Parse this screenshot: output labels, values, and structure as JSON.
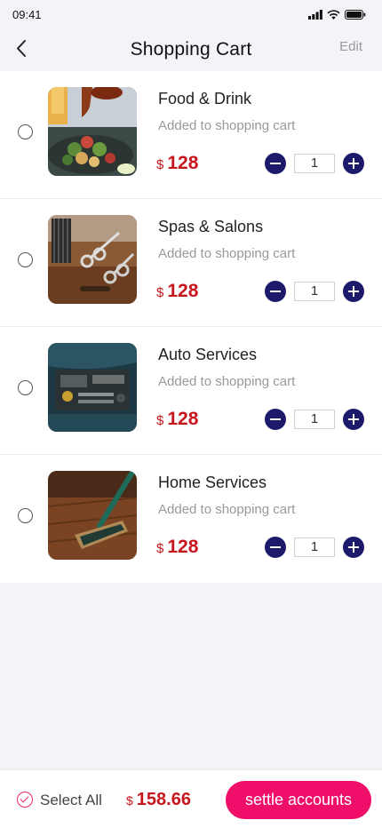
{
  "status": {
    "time": "09:41"
  },
  "nav": {
    "title": "Shopping Cart",
    "edit_label": "Edit"
  },
  "cart": {
    "items": [
      {
        "name": "Food & Drink",
        "subtitle": "Added to shopping cart",
        "currency": "$",
        "price": "128",
        "qty": "1",
        "image": "food-photo"
      },
      {
        "name": "Spas & Salons",
        "subtitle": "Added to shopping cart",
        "currency": "$",
        "price": "128",
        "qty": "1",
        "image": "salon-scissors-photo"
      },
      {
        "name": "Auto Services",
        "subtitle": "Added to shopping cart",
        "currency": "$",
        "price": "128",
        "qty": "1",
        "image": "car-engine-photo"
      },
      {
        "name": "Home Services",
        "subtitle": "Added to shopping cart",
        "currency": "$",
        "price": "128",
        "qty": "1",
        "image": "mop-floor-photo"
      }
    ]
  },
  "footer": {
    "select_all_label": "Select All",
    "currency": "$",
    "total": "158.66",
    "settle_label": "settle accounts"
  },
  "colors": {
    "accent": "#ef0f6b",
    "price": "#c8161d",
    "stepper": "#1b1a6b"
  }
}
